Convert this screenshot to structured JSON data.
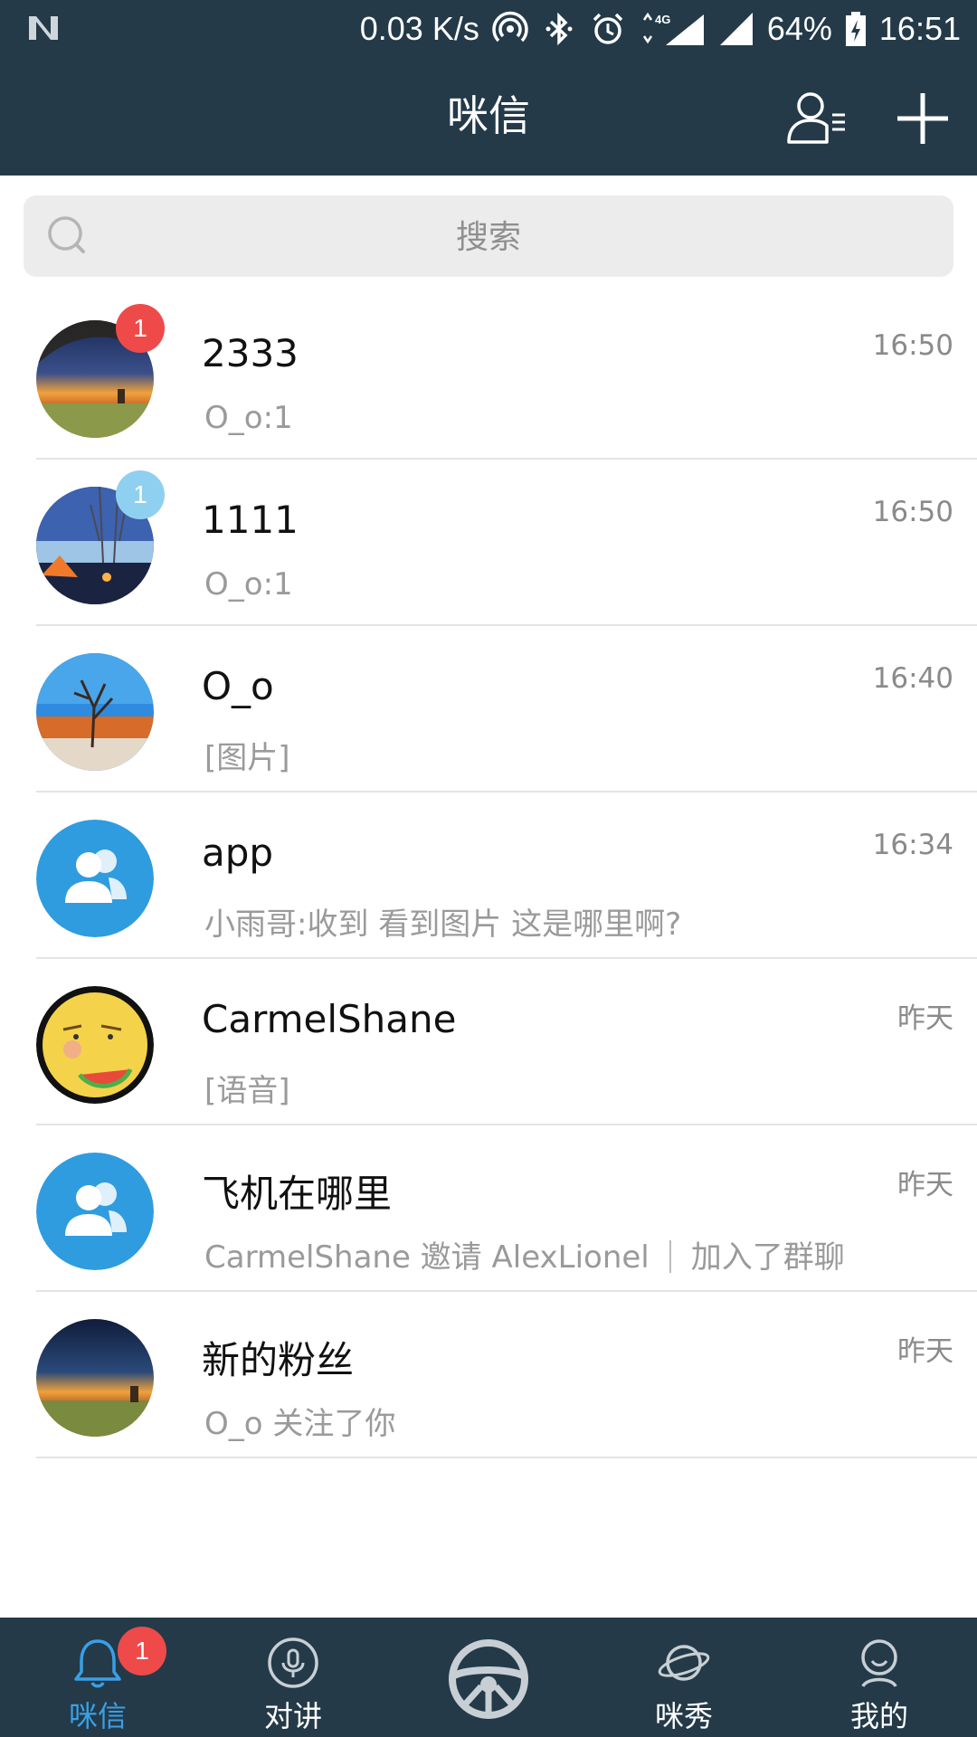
{
  "status_bar": {
    "speed": "0.03 K/s",
    "network": "4G",
    "battery": "64%",
    "time": "16:51",
    "icons": [
      "notification-n-icon",
      "hotspot-icon",
      "bluetooth-icon",
      "alarm-icon",
      "data-arrows-icon",
      "signal-icon",
      "signal-icon",
      "battery-icon"
    ]
  },
  "header": {
    "title": "咪信",
    "contacts_icon": "contacts-list-icon",
    "add_icon": "plus-icon"
  },
  "search": {
    "placeholder": "搜索",
    "icon": "search-icon"
  },
  "conversations": [
    {
      "name": "2333",
      "message": "O_o:1",
      "time": "16:50",
      "badge": "1",
      "badge_color": "#ef4a4a",
      "avatar": "sunset-field-photo"
    },
    {
      "name": "1111",
      "message": "O_o:1",
      "time": "16:50",
      "badge": "1",
      "badge_color": "#8fd0f0",
      "avatar": "tent-lake-photo"
    },
    {
      "name": "O_o",
      "message": "[图片]",
      "time": "16:40",
      "avatar": "desert-tree-photo"
    },
    {
      "name": "app",
      "message": "小雨哥:收到 看到图片 这是哪里啊?",
      "time": "16:34",
      "avatar": "group-icon"
    },
    {
      "name": "CarmelShane",
      "message": "[语音]",
      "time": "昨天",
      "avatar": "emoji-watermelon"
    },
    {
      "name": "飞机在哪里",
      "message_a": "CarmelShane 邀请 AlexLionel",
      "message_b": "加入了群聊",
      "time": "昨天",
      "avatar": "group-icon"
    },
    {
      "name": "新的粉丝",
      "message": "O_o 关注了你",
      "time": "昨天",
      "avatar": "night-field-photo"
    }
  ],
  "bottom_nav": {
    "items": [
      {
        "label": "咪信",
        "icon": "bell-icon",
        "active": true,
        "badge": "1"
      },
      {
        "label": "对讲",
        "icon": "microphone-icon"
      },
      {
        "label": "",
        "icon": "steering-wheel-icon"
      },
      {
        "label": "咪秀",
        "icon": "planet-icon"
      },
      {
        "label": "我的",
        "icon": "person-icon"
      }
    ]
  },
  "colors": {
    "header_bg": "#243a49",
    "accent": "#3aa0e6",
    "badge_red": "#ef4a4a",
    "badge_blue": "#8fd0f0"
  }
}
